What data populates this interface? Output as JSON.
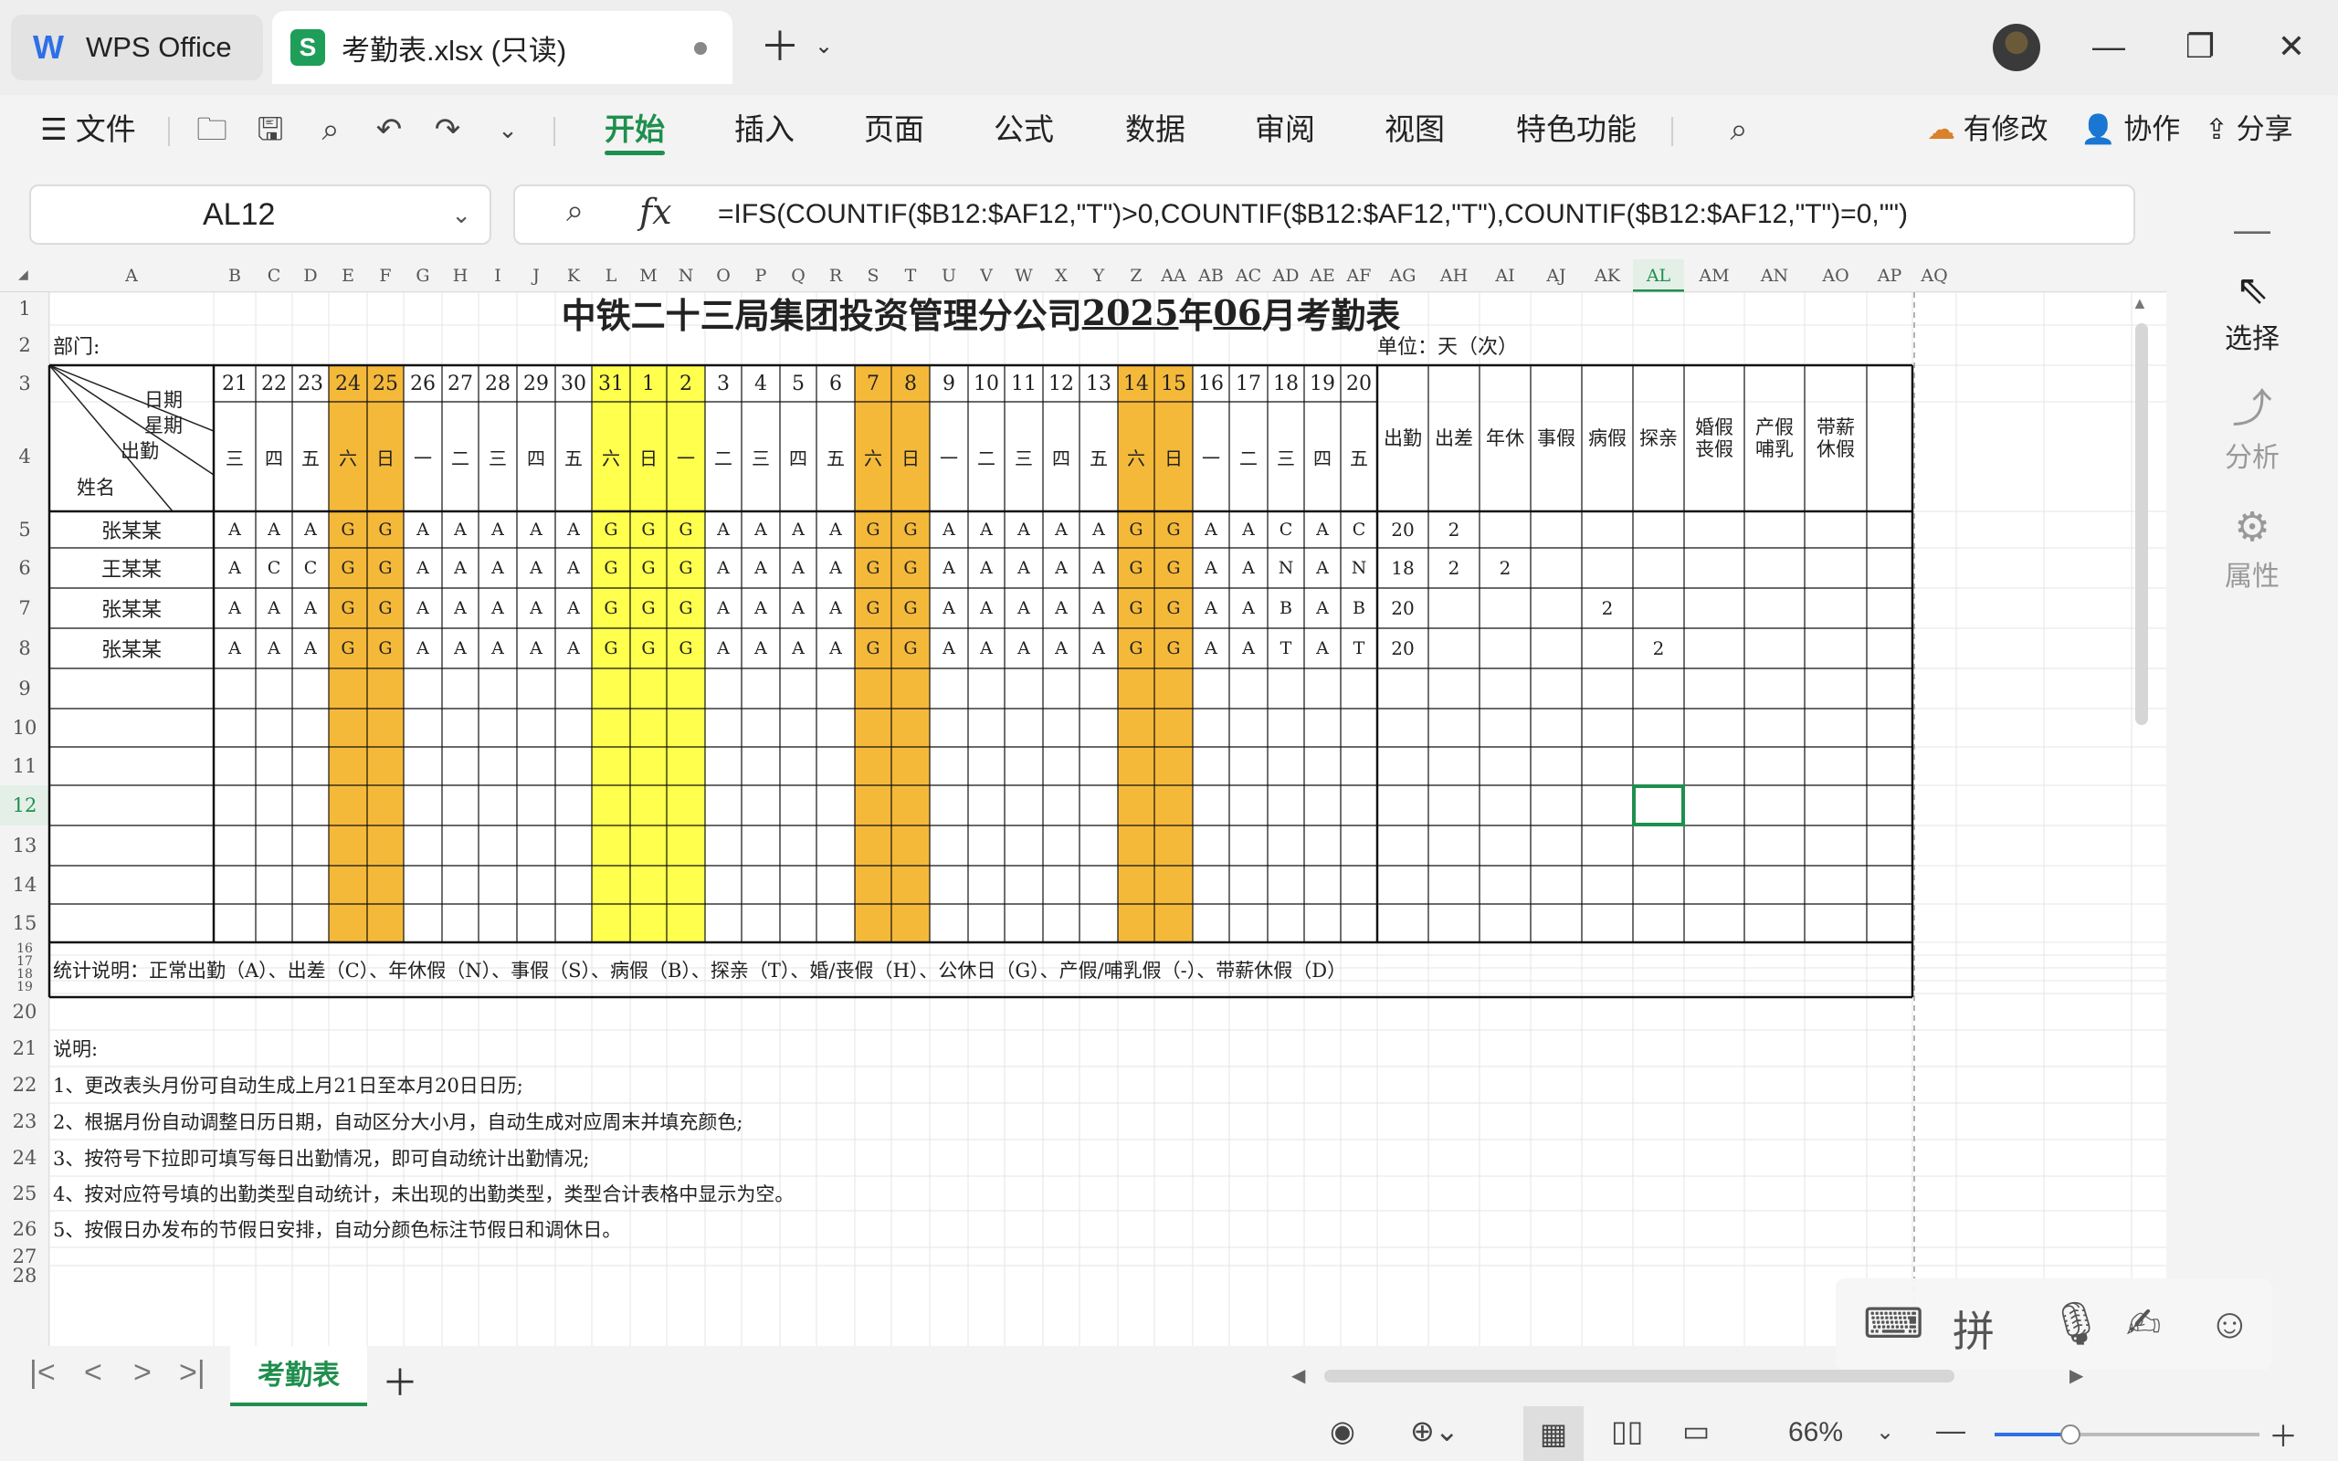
{
  "tabs": {
    "home_label": "WPS Office",
    "file_label": "考勤表.xlsx (只读)"
  },
  "ribbon": {
    "menu_file": "文件",
    "tabs": [
      "开始",
      "插入",
      "页面",
      "公式",
      "数据",
      "审阅",
      "视图",
      "特色功能"
    ],
    "active_tab": "开始",
    "modified": "有修改",
    "collab": "协作",
    "share": "分享"
  },
  "formula_bar": {
    "cell_ref": "AL12",
    "formula": "=IFS(COUNTIF($B12:$AF12,\"T\")>0,COUNTIF($B12:$AF12,\"T\"),COUNTIF($B12:$AF12,\"T\")=0,\"\")"
  },
  "side_panel": [
    "选择",
    "分析",
    "属性"
  ],
  "columns": [
    "A",
    "B",
    "C",
    "D",
    "E",
    "F",
    "G",
    "H",
    "I",
    "J",
    "K",
    "L",
    "M",
    "N",
    "O",
    "P",
    "Q",
    "R",
    "S",
    "T",
    "U",
    "V",
    "W",
    "X",
    "Y",
    "Z",
    "AA",
    "AB",
    "AC",
    "AD",
    "AE",
    "AF",
    "AG",
    "AH",
    "AI",
    "AJ",
    "AK",
    "AL",
    "AM",
    "AN",
    "AO",
    "AP",
    "AQ"
  ],
  "selected_column": "AL",
  "selected_row": 12,
  "rows": [
    "1",
    "2",
    "3",
    "4",
    "5",
    "6",
    "7",
    "8",
    "9",
    "10",
    "11",
    "12",
    "13",
    "14",
    "15",
    "16",
    "17",
    "18",
    "19",
    "20",
    "21",
    "22",
    "23",
    "24",
    "25",
    "26",
    "27",
    "28"
  ],
  "sheet": {
    "title_pre": "中铁二十三局集团投资管理分公司",
    "title_year": "2025",
    "title_mid": "年",
    "title_month": "06",
    "title_post": "月考勤表",
    "dept_label": "部门:",
    "unit_label": "单位：天（次）",
    "corner_date": "日期",
    "corner_week": "星期",
    "corner_attend": "出勤",
    "corner_name": "姓名",
    "days": [
      "21",
      "22",
      "23",
      "24",
      "25",
      "26",
      "27",
      "28",
      "29",
      "30",
      "31",
      "1",
      "2",
      "3",
      "4",
      "5",
      "6",
      "7",
      "8",
      "9",
      "10",
      "11",
      "12",
      "13",
      "14",
      "15",
      "16",
      "17",
      "18",
      "19",
      "20"
    ],
    "weekdays": [
      "三",
      "四",
      "五",
      "六",
      "日",
      "一",
      "二",
      "三",
      "四",
      "五",
      "六",
      "日",
      "一",
      "二",
      "三",
      "四",
      "五",
      "六",
      "日",
      "一",
      "二",
      "三",
      "四",
      "五",
      "六",
      "日",
      "一",
      "二",
      "三",
      "四",
      "五"
    ],
    "day_types": [
      "w",
      "w",
      "w",
      "o",
      "o",
      "w",
      "w",
      "w",
      "w",
      "w",
      "y",
      "y",
      "y",
      "w",
      "w",
      "w",
      "w",
      "o",
      "o",
      "w",
      "w",
      "w",
      "w",
      "w",
      "o",
      "o",
      "w",
      "w",
      "w",
      "w",
      "w"
    ],
    "stat_headers": [
      "出勤",
      "出差",
      "年休",
      "事假",
      "病假",
      "探亲",
      "婚假\n丧假",
      "产假\n哺乳",
      "带薪\n休假"
    ],
    "employees": [
      {
        "name": "张某某",
        "marks": [
          "A",
          "A",
          "A",
          "G",
          "G",
          "A",
          "A",
          "A",
          "A",
          "A",
          "G",
          "G",
          "G",
          "A",
          "A",
          "A",
          "A",
          "G",
          "G",
          "A",
          "A",
          "A",
          "A",
          "A",
          "G",
          "G",
          "A",
          "A",
          "C",
          "A",
          "C"
        ],
        "stats": [
          "20",
          "2",
          "",
          "",
          "",
          "",
          "",
          "",
          ""
        ]
      },
      {
        "name": "王某某",
        "marks": [
          "A",
          "C",
          "C",
          "G",
          "G",
          "A",
          "A",
          "A",
          "A",
          "A",
          "G",
          "G",
          "G",
          "A",
          "A",
          "A",
          "A",
          "G",
          "G",
          "A",
          "A",
          "A",
          "A",
          "A",
          "G",
          "G",
          "A",
          "A",
          "N",
          "A",
          "N"
        ],
        "stats": [
          "18",
          "2",
          "2",
          "",
          "",
          "",
          "",
          "",
          ""
        ]
      },
      {
        "name": "张某某",
        "marks": [
          "A",
          "A",
          "A",
          "G",
          "G",
          "A",
          "A",
          "A",
          "A",
          "A",
          "G",
          "G",
          "G",
          "A",
          "A",
          "A",
          "A",
          "G",
          "G",
          "A",
          "A",
          "A",
          "A",
          "A",
          "G",
          "G",
          "A",
          "A",
          "B",
          "A",
          "B"
        ],
        "stats": [
          "20",
          "",
          "",
          "",
          "2",
          "",
          "",
          "",
          ""
        ]
      },
      {
        "name": "张某某",
        "marks": [
          "A",
          "A",
          "A",
          "G",
          "G",
          "A",
          "A",
          "A",
          "A",
          "A",
          "G",
          "G",
          "G",
          "A",
          "A",
          "A",
          "A",
          "G",
          "G",
          "A",
          "A",
          "A",
          "A",
          "A",
          "G",
          "G",
          "A",
          "A",
          "T",
          "A",
          "T"
        ],
        "stats": [
          "20",
          "",
          "",
          "",
          "",
          "2",
          "",
          "",
          ""
        ]
      }
    ],
    "stat_note": "统计说明：正常出勤（A）、出差（C）、年休假（N）、事假（S）、病假（B）、探亲（T）、婚/丧假（H）、公休日（G）、产假/哺乳假（-）、带薪休假（D）",
    "notes_title": "说明:",
    "notes": [
      "1、更改表头月份可自动生成上月21日至本月20日日历;",
      "2、根据月份自动调整日历日期，自动区分大小月，自动生成对应周末并填充颜色;",
      "3、按符号下拉即可填写每日出勤情况，即可自动统计出勤情况;",
      "4、按对应符号填的出勤类型自动统计，未出现的出勤类型，类型合计表格中显示为空。",
      "5、按假日办发布的节假日安排，自动分颜色标注节假日和调休日。"
    ]
  },
  "sheet_tab": "考勤表",
  "status": {
    "zoom": "66%",
    "zoom_fraction": 0.66
  },
  "colors": {
    "weekend": "#f5b93a",
    "holiday": "#ffff4d",
    "accent": "#1f8f4e"
  }
}
